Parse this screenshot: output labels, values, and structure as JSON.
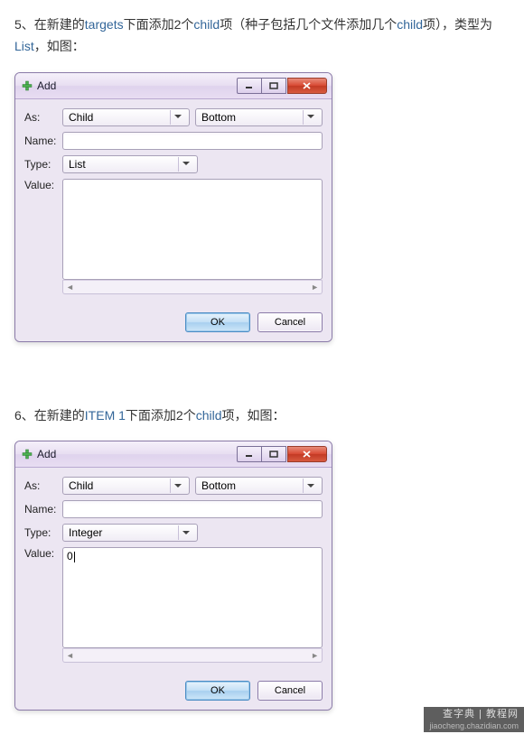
{
  "step5": {
    "prefix": "5、在新建的",
    "link1": "targets",
    "mid1": "下面添加2个",
    "link2": "child",
    "mid2": "项（种子包括几个文件添加几个",
    "link3": "child",
    "mid3": "项），类型为",
    "link4": "List",
    "suffix": "，如图："
  },
  "step6": {
    "prefix": "6、在新建的",
    "link1": "ITEM 1",
    "mid1": "下面添加2个",
    "link2": "child",
    "suffix": "项，如图："
  },
  "dialog1": {
    "title": "Add",
    "as_label": "As:",
    "as_value": "Child",
    "pos_value": "Bottom",
    "name_label": "Name:",
    "name_value": "",
    "type_label": "Type:",
    "type_value": "List",
    "value_label": "Value:",
    "value_text": "",
    "ok": "OK",
    "cancel": "Cancel"
  },
  "dialog2": {
    "title": "Add",
    "as_label": "As:",
    "as_value": "Child",
    "pos_value": "Bottom",
    "name_label": "Name:",
    "name_value": "",
    "type_label": "Type:",
    "type_value": "Integer",
    "value_label": "Value:",
    "value_text": "0",
    "ok": "OK",
    "cancel": "Cancel"
  },
  "watermark": {
    "line1": "查字典 | 教程网",
    "line2": "jiaocheng.chazidian.com"
  }
}
